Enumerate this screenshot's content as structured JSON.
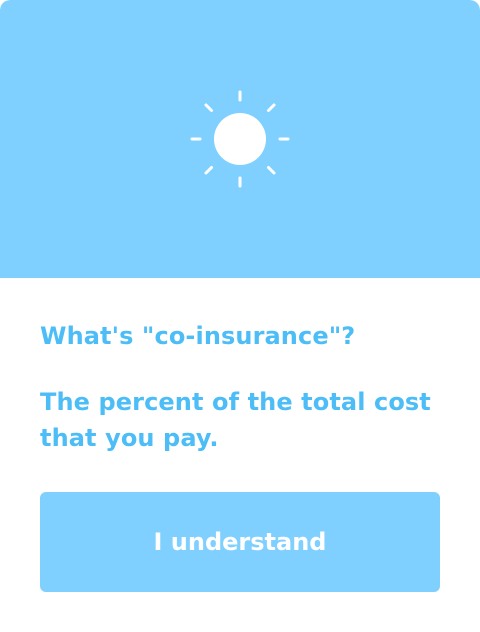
{
  "colors": {
    "hero_background": "#80d0ff",
    "text_accent": "#4cbdf6",
    "button_background": "#80d0ff",
    "button_text": "#ffffff"
  },
  "hero": {
    "icon": "sun-icon"
  },
  "content": {
    "question": "What's \"co-insurance\"?",
    "answer": "The percent of the total cost that you pay."
  },
  "actions": {
    "confirm_label": "I understand"
  }
}
